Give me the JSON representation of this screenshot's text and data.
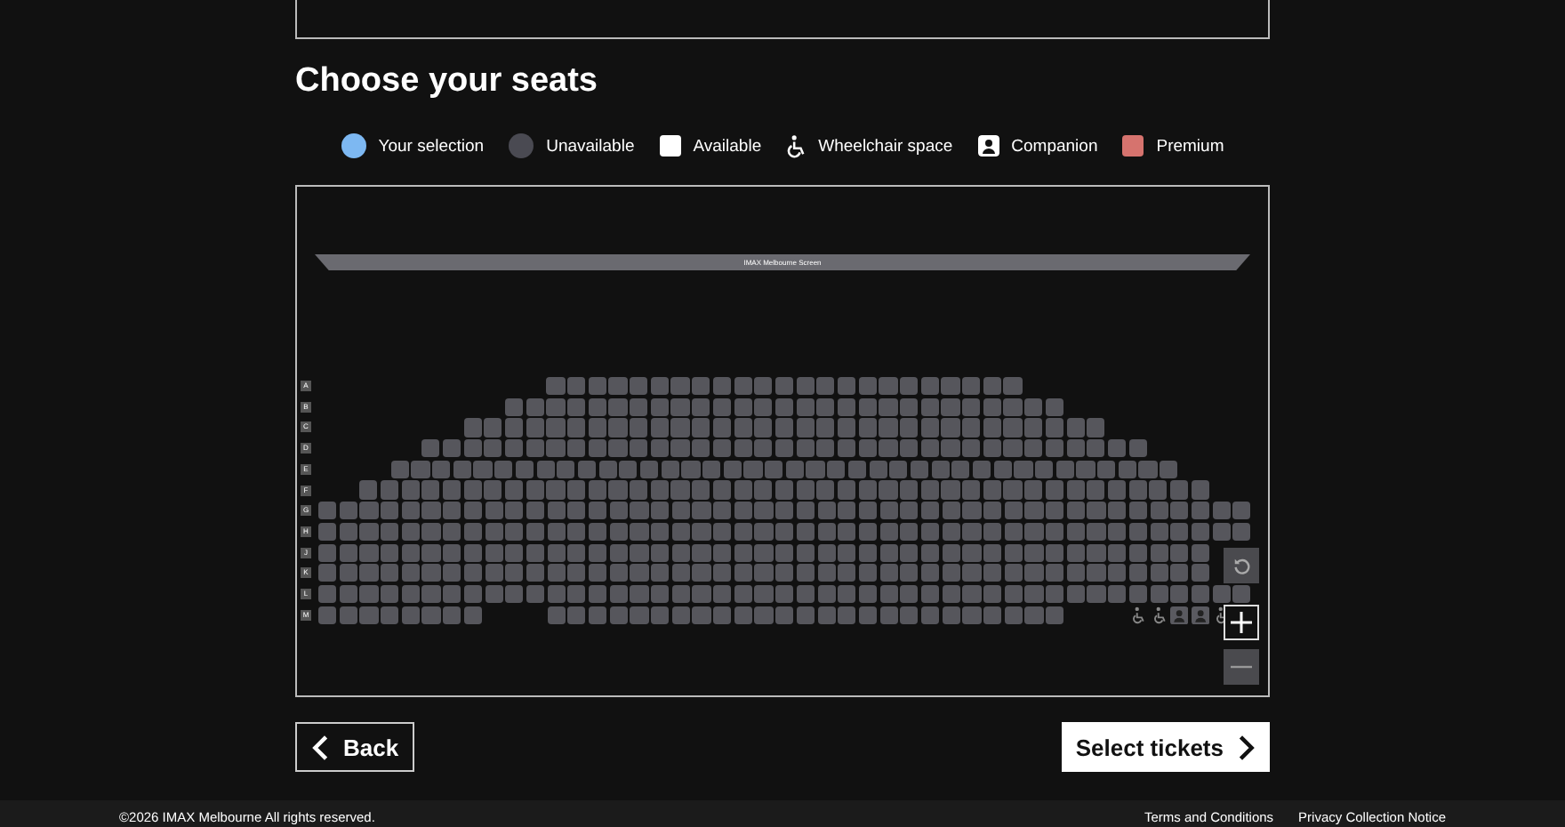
{
  "heading": "Choose your seats",
  "legend": [
    {
      "kind": "selection",
      "label": "Your selection"
    },
    {
      "kind": "unavailable",
      "label": "Unavailable"
    },
    {
      "kind": "available",
      "label": "Available"
    },
    {
      "kind": "wheelchair",
      "label": "Wheelchair space"
    },
    {
      "kind": "companion",
      "label": "Companion"
    },
    {
      "kind": "premium",
      "label": "Premium"
    }
  ],
  "seat_map": {
    "screen_label": "IMAX Melbourne Screen",
    "rows": [
      {
        "label": "A",
        "kind": "centered",
        "blocks": [
          [
            false,
            false,
            false,
            false,
            false,
            false,
            false,
            false,
            false,
            false,
            false,
            false,
            false,
            false,
            false,
            false,
            false,
            false,
            false,
            false,
            false,
            false,
            false
          ]
        ]
      },
      {
        "label": "B",
        "kind": "centered",
        "blocks": [
          [
            false,
            false,
            false,
            false,
            false,
            false,
            false,
            false,
            false,
            false,
            false,
            false,
            false,
            false,
            false,
            false,
            false,
            false,
            false,
            false,
            false,
            false,
            false,
            false,
            false,
            false,
            false
          ]
        ]
      },
      {
        "label": "C",
        "kind": "centered",
        "blocks": [
          [
            false,
            false,
            false,
            false,
            false,
            false,
            false,
            false,
            false,
            false,
            false,
            false,
            false,
            false,
            false,
            false,
            false,
            false,
            false,
            false,
            false,
            false,
            false,
            false,
            false,
            false,
            false,
            false,
            false,
            false,
            false
          ]
        ]
      },
      {
        "label": "D",
        "kind": "centered",
        "blocks": [
          [
            false,
            false,
            false,
            false,
            false,
            false,
            false,
            false,
            false,
            false,
            false,
            false,
            false,
            false,
            false,
            false,
            false,
            false,
            false,
            false,
            false,
            false,
            false,
            false,
            false,
            false,
            false,
            false,
            false,
            false,
            false,
            false,
            false,
            false,
            false
          ]
        ]
      },
      {
        "label": "E",
        "kind": "centered",
        "blocks": [
          [
            false,
            false,
            false,
            false,
            false,
            false,
            false,
            false,
            false,
            false,
            false,
            false,
            false,
            false,
            false,
            false,
            false,
            false,
            false,
            false,
            false,
            false,
            false,
            false,
            false,
            false,
            false,
            false,
            false,
            false,
            false,
            false,
            false,
            false,
            false,
            false,
            false,
            false
          ]
        ]
      },
      {
        "label": "F",
        "kind": "centered",
        "blocks": [
          [
            false,
            false,
            false,
            false,
            false,
            false,
            false,
            false,
            false,
            false,
            false,
            false,
            false,
            false,
            false,
            false,
            false,
            false,
            false,
            false,
            false,
            false,
            false,
            false,
            false,
            false,
            false,
            false,
            false,
            false,
            false,
            false,
            false,
            false,
            false,
            false,
            false,
            false,
            false,
            false,
            false
          ]
        ]
      },
      {
        "label": "G",
        "kind": "left",
        "blocks": [
          [
            false,
            false,
            false,
            false,
            false,
            false,
            false,
            false,
            false,
            false,
            false,
            false,
            false,
            false,
            false,
            false,
            false,
            false,
            false,
            false,
            false,
            false,
            false,
            false,
            false,
            false,
            false,
            false,
            false,
            false,
            false,
            false,
            false,
            false,
            false,
            false,
            false,
            false,
            false,
            false,
            false,
            false,
            false,
            false,
            false
          ]
        ]
      },
      {
        "label": "H",
        "kind": "left",
        "blocks": [
          [
            false,
            false,
            false,
            false,
            false,
            false,
            false,
            false,
            false,
            false,
            false,
            false,
            false,
            false,
            false,
            false,
            false,
            false,
            false,
            false,
            false,
            false,
            false,
            false,
            false,
            false,
            false,
            false,
            false,
            false,
            false,
            false,
            false,
            false,
            false,
            false,
            false,
            false,
            false,
            false,
            false,
            false,
            false,
            false,
            false
          ]
        ]
      },
      {
        "label": "J",
        "kind": "left",
        "blocks": [
          [
            false,
            false,
            false,
            false,
            false,
            false,
            false,
            false,
            false,
            false,
            false,
            false,
            false,
            false,
            false,
            false,
            false,
            false,
            false,
            false,
            false,
            false,
            false,
            false,
            false,
            false,
            false,
            false,
            false,
            false,
            false,
            false,
            false,
            false,
            false,
            false,
            false,
            false,
            false,
            false,
            false,
            false,
            false
          ]
        ]
      },
      {
        "label": "K",
        "kind": "left",
        "blocks": [
          [
            false,
            false,
            false,
            false,
            false,
            false,
            false,
            false,
            false,
            false,
            false,
            false,
            false,
            false,
            false,
            false,
            false,
            false,
            false,
            false,
            false,
            false,
            false,
            false,
            false,
            false,
            false,
            false,
            false,
            false,
            false,
            false,
            false,
            false,
            false,
            false,
            false,
            false,
            false,
            false,
            false,
            false,
            false
          ]
        ]
      },
      {
        "label": "L",
        "kind": "left",
        "blocks": [
          [
            false,
            false,
            false,
            false,
            false,
            false,
            false,
            false,
            false,
            false,
            false,
            false,
            false,
            false,
            false,
            false,
            false,
            false,
            false,
            false,
            false,
            false,
            false,
            false,
            false,
            false,
            false,
            false,
            false,
            false,
            false,
            false,
            false,
            false,
            false,
            false,
            false,
            false,
            false,
            false,
            false,
            false,
            false,
            false,
            false
          ]
        ]
      },
      {
        "label": "M",
        "kind": "left",
        "blocks": [
          [
            false,
            false,
            false,
            false,
            false,
            false,
            false,
            false
          ],
          [
            false,
            false,
            false,
            false,
            false,
            false,
            false,
            false,
            false,
            false,
            false,
            false,
            false,
            false,
            false,
            false,
            false,
            false,
            false,
            false,
            false,
            false,
            false,
            false,
            false
          ]
        ],
        "spaces": [
          {
            "kind": "wheelchair"
          },
          {
            "kind": "wheelchair"
          },
          {
            "kind": "companion"
          },
          {
            "kind": "companion"
          },
          {
            "kind": "wheelchair"
          }
        ]
      }
    ]
  },
  "back_button": "Back",
  "next_button": "Select tickets",
  "footer": {
    "copyright": "©2026 IMAX Melbourne All rights reserved.",
    "links": [
      "Terms and Conditions",
      "Privacy Collection Notice"
    ]
  }
}
